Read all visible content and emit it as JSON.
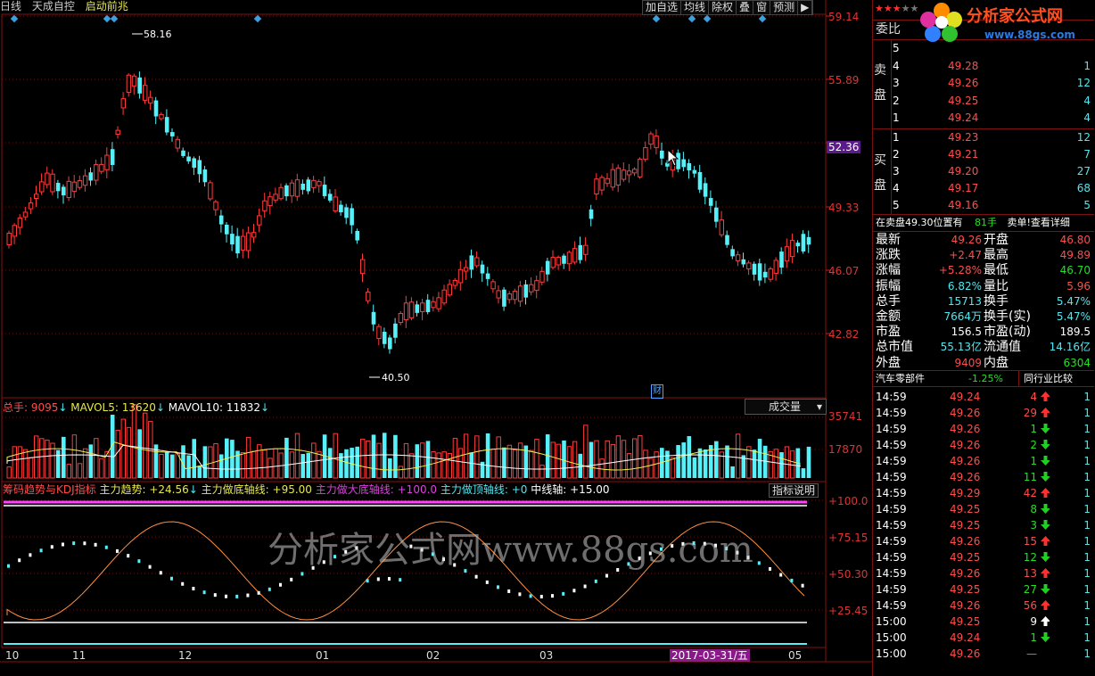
{
  "header": {
    "items": [
      "日线",
      "天成自控",
      "启动前兆"
    ]
  },
  "toolbar": [
    "加自选",
    "均线",
    "除权",
    "叠",
    "窗",
    "预测",
    "▶"
  ],
  "price_axis": [
    "59.14",
    "55.89",
    "52.36",
    "49.33",
    "46.07",
    "42.82"
  ],
  "price_labels": {
    "high": "58.16",
    "low": "40.50",
    "fin": "财"
  },
  "volume": {
    "total_label": "总手: 9095",
    "mavol5": "MAVOL5: 13620",
    "mavol10": "MAVOL10: 11832",
    "axis": [
      "35741",
      "17870"
    ],
    "selector": "成交量"
  },
  "indicator": {
    "name": "筹码趋势与KDJ指标",
    "trend": "主力趋势: +24.56",
    "bottom": "主力做底轴线: +95.00",
    "big_bottom": "主力做大底轴线: +100.0",
    "top": "主力做顶轴线: +0",
    "mid": "中线轴: +15.00",
    "help": "指标说明",
    "axis": [
      "+100.0",
      "+75.15",
      "+50.30",
      "+25.45"
    ]
  },
  "x_axis": [
    "10",
    "11",
    "12",
    "01",
    "02",
    "03",
    "05"
  ],
  "date_badge": "2017-03-31/五",
  "watermark": "分析家公式网www.88gs.com",
  "logo": {
    "name": "分析家公式网",
    "url": "www.88gs.com"
  },
  "panel": {
    "weibi": "委比",
    "sell_label": "卖盘",
    "buy_label": "买盘",
    "sell": [
      {
        "n": "5",
        "p": "",
        "v": ""
      },
      {
        "n": "4",
        "p": "49.28",
        "v": "1"
      },
      {
        "n": "3",
        "p": "49.26",
        "v": "12"
      },
      {
        "n": "2",
        "p": "49.25",
        "v": "4"
      },
      {
        "n": "1",
        "p": "49.24",
        "v": "4"
      }
    ],
    "buy": [
      {
        "n": "1",
        "p": "49.23",
        "v": "12"
      },
      {
        "n": "2",
        "p": "49.21",
        "v": "7"
      },
      {
        "n": "3",
        "p": "49.20",
        "v": "27"
      },
      {
        "n": "4",
        "p": "49.17",
        "v": "68"
      },
      {
        "n": "5",
        "p": "49.16",
        "v": "5"
      }
    ],
    "notice": "在卖盘49.30位置有",
    "notice_hands": "81手",
    "notice_link": "卖单!查看详细",
    "stats": [
      [
        "最新",
        "49.26",
        "开盘",
        "46.80"
      ],
      [
        "涨跌",
        "+2.47",
        "最高",
        "49.89"
      ],
      [
        "涨幅",
        "+5.28%",
        "最低",
        "46.70"
      ],
      [
        "振幅",
        "6.82%",
        "量比",
        "5.96"
      ],
      [
        "总手",
        "15713",
        "换手",
        "5.47%"
      ],
      [
        "金额",
        "7664万",
        "换手(实)",
        "5.47%"
      ],
      [
        "市盈",
        "156.5",
        "市盈(动)",
        "189.5"
      ],
      [
        "总市值",
        "55.13亿",
        "流通值",
        "14.16亿"
      ],
      [
        "外盘",
        "9409",
        "内盘",
        "6304"
      ]
    ],
    "industry": "汽车零部件",
    "industry_pct": "-1.25%",
    "compare": "同行业比较",
    "ticks": [
      [
        "14:59",
        "49.24",
        "4",
        "up"
      ],
      [
        "14:59",
        "49.26",
        "29",
        "up"
      ],
      [
        "14:59",
        "49.26",
        "1",
        "down"
      ],
      [
        "14:59",
        "49.26",
        "2",
        "down"
      ],
      [
        "14:59",
        "49.26",
        "1",
        "down"
      ],
      [
        "14:59",
        "49.26",
        "11",
        "down"
      ],
      [
        "14:59",
        "49.29",
        "42",
        "up"
      ],
      [
        "14:59",
        "49.25",
        "8",
        "down"
      ],
      [
        "14:59",
        "49.25",
        "3",
        "down"
      ],
      [
        "14:59",
        "49.26",
        "15",
        "up"
      ],
      [
        "14:59",
        "49.25",
        "12",
        "down"
      ],
      [
        "14:59",
        "49.26",
        "13",
        "up"
      ],
      [
        "14:59",
        "49.25",
        "27",
        "down"
      ],
      [
        "14:59",
        "49.26",
        "56",
        "up"
      ],
      [
        "15:00",
        "49.25",
        "9",
        "white"
      ],
      [
        "15:00",
        "49.24",
        "1",
        "down"
      ],
      [
        "15:00",
        "49.26",
        "—",
        "none"
      ]
    ]
  }
}
